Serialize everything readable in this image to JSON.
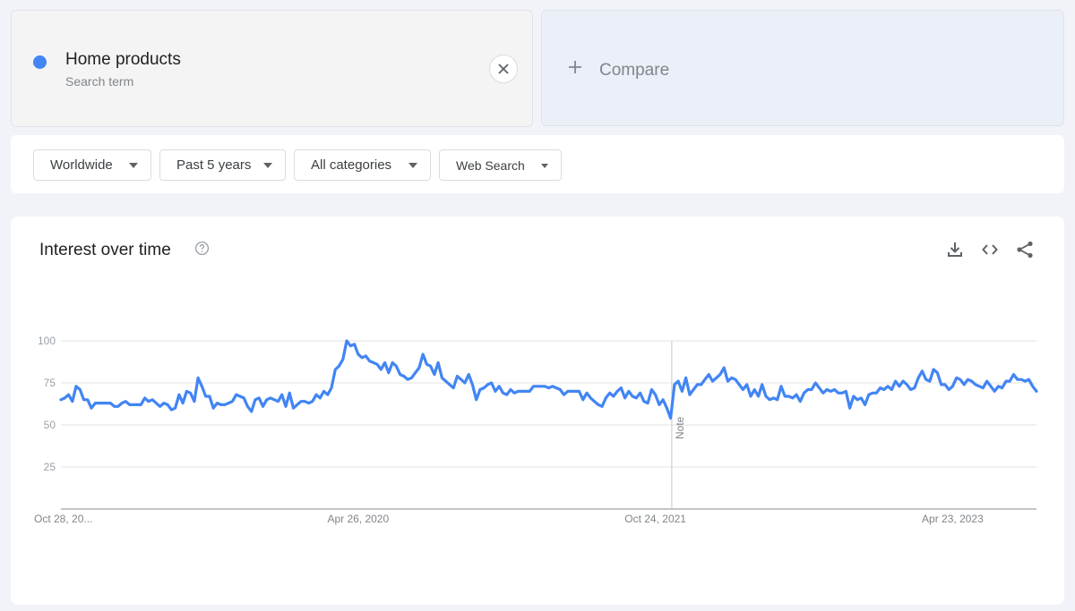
{
  "search_term": {
    "name": "Home products",
    "type_label": "Search term",
    "color": "#4285f4",
    "remove_icon": "close-icon"
  },
  "compare": {
    "label": "Compare",
    "icon": "plus-icon"
  },
  "filters": [
    {
      "label": "Worldwide"
    },
    {
      "label": "Past 5 years"
    },
    {
      "label": "All categories"
    },
    {
      "label": "Web Search"
    }
  ],
  "panel": {
    "title": "Interest over time",
    "help_icon": "help-circle-icon",
    "actions": [
      "download-icon",
      "embed-code-icon",
      "share-icon"
    ]
  },
  "chart_data": {
    "type": "line",
    "title": "Interest over time",
    "xlabel": "",
    "ylabel": "",
    "ylim": [
      0,
      100
    ],
    "yticks": [
      25,
      50,
      75,
      100
    ],
    "grid": true,
    "legend": "none",
    "x_tick_labels": [
      {
        "label": "Oct 28, 20...",
        "index": 0
      },
      {
        "label": "Apr 26, 2020",
        "index": 78
      },
      {
        "label": "Oct 24, 2021",
        "index": 156
      },
      {
        "label": "Apr 23, 2023",
        "index": 234
      }
    ],
    "annotations": [
      {
        "label": "Note",
        "index": 161
      }
    ],
    "series": [
      {
        "name": "Home products",
        "color": "#4285f4",
        "values": [
          65,
          66,
          68,
          64,
          73,
          71,
          65,
          65,
          60,
          63,
          63,
          63,
          63,
          63,
          61,
          61,
          63,
          64,
          62,
          62,
          62,
          62,
          66,
          64,
          65,
          63,
          61,
          63,
          62,
          59,
          60,
          68,
          63,
          70,
          69,
          64,
          78,
          73,
          67,
          67,
          60,
          63,
          62,
          62,
          63,
          64,
          68,
          67,
          66,
          61,
          58,
          65,
          66,
          61,
          65,
          66,
          65,
          64,
          68,
          61,
          69,
          60,
          62,
          64,
          64,
          63,
          64,
          68,
          66,
          70,
          68,
          72,
          83,
          85,
          89,
          100,
          97,
          98,
          92,
          90,
          91,
          88,
          87,
          86,
          83,
          87,
          81,
          87,
          85,
          80,
          79,
          77,
          78,
          81,
          84,
          92,
          86,
          85,
          80,
          87,
          78,
          76,
          74,
          72,
          79,
          77,
          75,
          80,
          74,
          65,
          71,
          72,
          74,
          75,
          70,
          73,
          69,
          68,
          71,
          69,
          70,
          70,
          70,
          70,
          73,
          73,
          73,
          73,
          72,
          73,
          72,
          71,
          68,
          70,
          70,
          70,
          70,
          65,
          69,
          66,
          64,
          62,
          61,
          66,
          69,
          67,
          70,
          72,
          66,
          70,
          67,
          66,
          69,
          64,
          63,
          71,
          68,
          62,
          65,
          60,
          54,
          74,
          76,
          70,
          78,
          68,
          71,
          74,
          74,
          77,
          80,
          76,
          78,
          80,
          84,
          76,
          78,
          77,
          74,
          71,
          74,
          67,
          71,
          67,
          74,
          67,
          65,
          66,
          65,
          73,
          67,
          67,
          66,
          68,
          64,
          69,
          71,
          71,
          75,
          72,
          69,
          71,
          70,
          71,
          69,
          69,
          70,
          60,
          67,
          65,
          66,
          62,
          68,
          69,
          69,
          72,
          71,
          73,
          71,
          76,
          73,
          76,
          74,
          71,
          72,
          78,
          82,
          77,
          76,
          83,
          81,
          74,
          74,
          71,
          73,
          78,
          77,
          74,
          77,
          76,
          74,
          73,
          72,
          76,
          73,
          70,
          73,
          72,
          76,
          76,
          80,
          77,
          77,
          76,
          77,
          73,
          70
        ]
      }
    ]
  }
}
